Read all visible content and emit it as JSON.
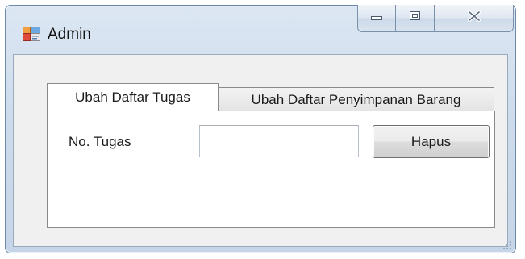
{
  "window": {
    "title": "Admin",
    "app_icon": "winforms-app-icon",
    "controls": {
      "minimize_icon": "minimize-icon",
      "maximize_icon": "maximize-icon",
      "close_icon": "close-icon"
    }
  },
  "tabs": [
    {
      "label": "Ubah Daftar Tugas",
      "active": true
    },
    {
      "label": "Ubah Daftar Penyimpanan Barang",
      "active": false
    }
  ],
  "form": {
    "no_tugas_label": "No. Tugas",
    "no_tugas_value": "",
    "hapus_label": "Hapus"
  },
  "colors": {
    "frame": "#c6d6e8",
    "client": "#f0f0f0",
    "tab_page": "#ffffff"
  }
}
